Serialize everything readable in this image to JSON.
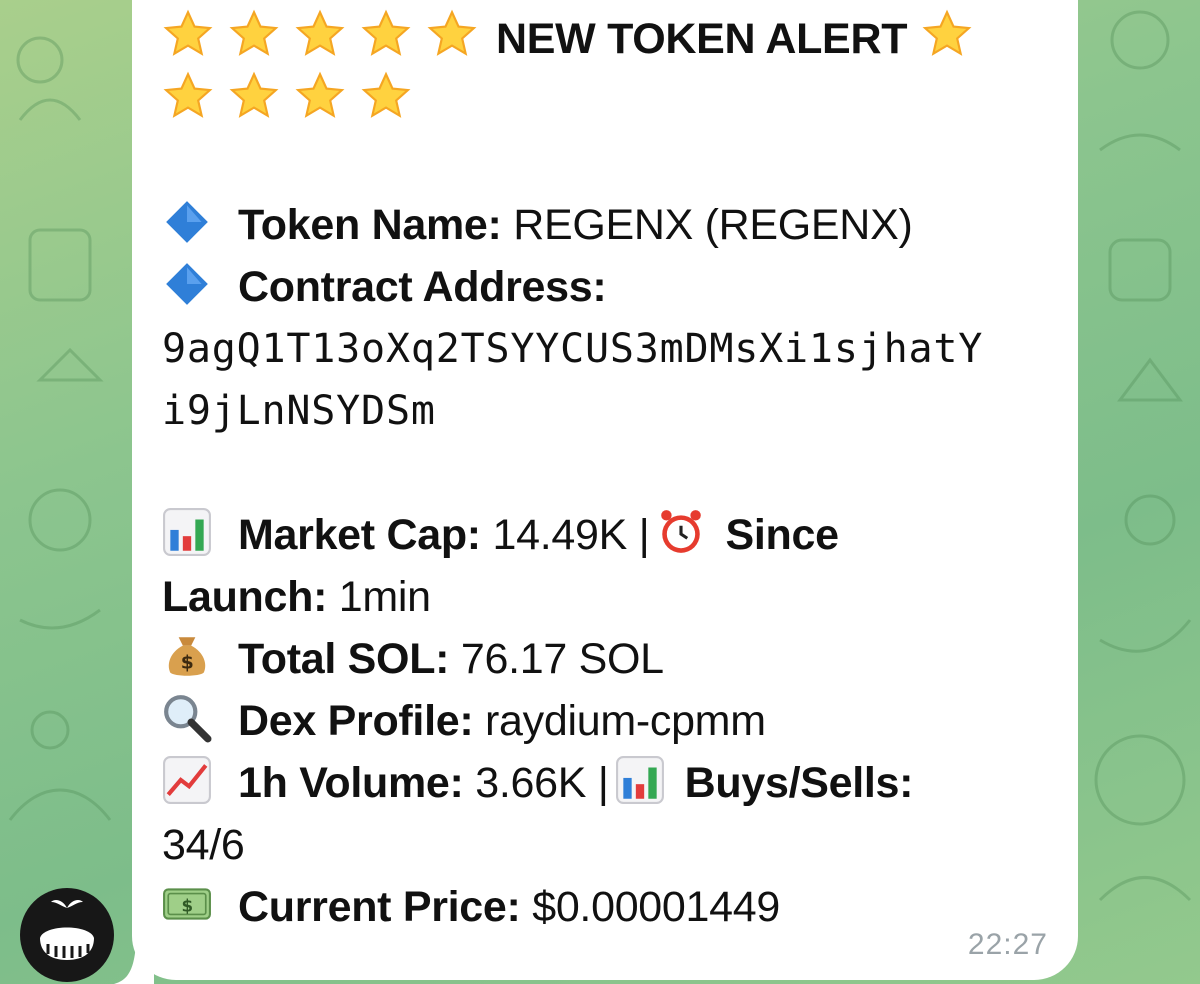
{
  "alert": {
    "title": "NEW TOKEN ALERT",
    "star_icon": "glowing-star-emoji",
    "stars_before_title": 5,
    "stars_after_title": 5
  },
  "token": {
    "name_label": "Token Name:",
    "name_value": "REGENX (REGENX)",
    "contract_label": "Contract Address:",
    "contract_line1": "9agQ1T13oXq2TSYYCUS3mDMsXi1sjhatY",
    "contract_line2": "i9jLnNSYDSm",
    "bullet_icon": "blue-diamond-emoji"
  },
  "stats": {
    "market_cap_label": "Market Cap:",
    "market_cap_value": "14.49K |",
    "since_label_a": "Since",
    "since_label_b": "Launch:",
    "since_value": "1min",
    "total_sol_label": "Total SOL:",
    "total_sol_value": "76.17 SOL",
    "dex_label": "Dex Profile:",
    "dex_value": "raydium-cpmm",
    "volume_label": "1h Volume:",
    "volume_value": "3.66K |",
    "buys_sells_label": "Buys/Sells:",
    "buys_sells_value": "34/6",
    "price_label": "Current Price:",
    "price_value": "$0.00001449"
  },
  "message": {
    "time": "22:27"
  },
  "colors": {
    "background": "#8cc58e",
    "bubble": "#ffffff",
    "text": "#111111",
    "timestamp": "#9aa3a8",
    "diamond": "#2f7fd8"
  }
}
